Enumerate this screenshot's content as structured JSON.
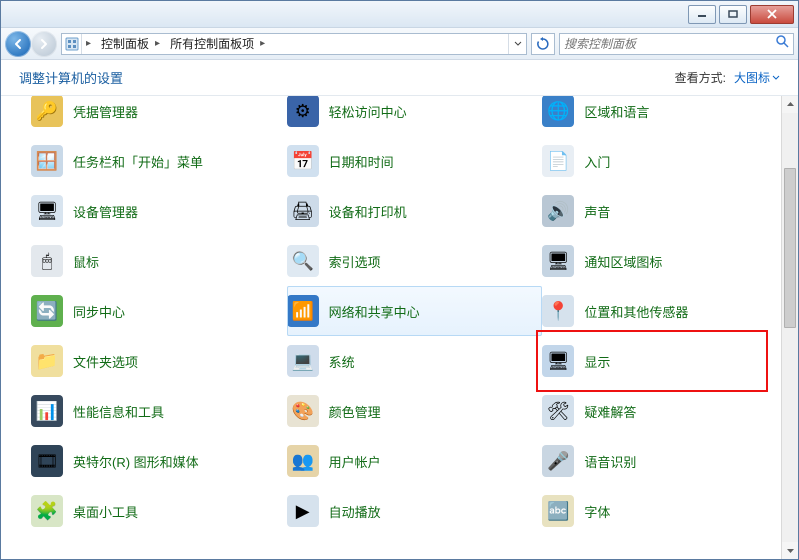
{
  "titlebar": {
    "minimize": "Minimize",
    "maximize": "Maximize",
    "close": "Close"
  },
  "breadcrumbs": [
    "控制面板",
    "所有控制面板项"
  ],
  "search": {
    "placeholder": "搜索控制面板"
  },
  "header": {
    "title": "调整计算机的设置",
    "view_label": "查看方式:",
    "view_value": "大图标"
  },
  "iconset": {
    "credential": "🔑",
    "ease": "⚙",
    "region": "🌐",
    "taskbar": "🪟",
    "datetime": "📅",
    "getting": "📄",
    "device_mgr": "🖥",
    "devices": "🖨",
    "sound": "🔊",
    "mouse": "🖱",
    "indexing": "🔍",
    "notification": "🖥",
    "sync": "🔄",
    "network": "📶",
    "sensors": "📍",
    "folder": "📁",
    "system": "💻",
    "display": "🖥",
    "perf": "📊",
    "color": "🎨",
    "troubleshoot": "🛠",
    "intel": "🎞",
    "users": "👥",
    "speech": "🎤",
    "gadgets": "🧩",
    "autoplay": "▶",
    "fonts": "🔤"
  },
  "items": [
    {
      "label": "凭据管理器",
      "icon": "credential",
      "bg": "#e8c35a"
    },
    {
      "label": "轻松访问中心",
      "icon": "ease",
      "bg": "#3a64a8"
    },
    {
      "label": "区域和语言",
      "icon": "region",
      "bg": "#3a80c8"
    },
    {
      "label": "任务栏和「开始」菜单",
      "icon": "taskbar",
      "bg": "#c9d9e8"
    },
    {
      "label": "日期和时间",
      "icon": "datetime",
      "bg": "#d0e0ef"
    },
    {
      "label": "入门",
      "icon": "getting",
      "bg": "#e8eef4"
    },
    {
      "label": "设备管理器",
      "icon": "device_mgr",
      "bg": "#d8e4ef"
    },
    {
      "label": "设备和打印机",
      "icon": "devices",
      "bg": "#cddbe9"
    },
    {
      "label": "声音",
      "icon": "sound",
      "bg": "#b9c7d4"
    },
    {
      "label": "鼠标",
      "icon": "mouse",
      "bg": "#e3e8ed"
    },
    {
      "label": "索引选项",
      "icon": "indexing",
      "bg": "#dfe9f2"
    },
    {
      "label": "通知区域图标",
      "icon": "notification",
      "bg": "#c5d4e2"
    },
    {
      "label": "同步中心",
      "icon": "sync",
      "bg": "#5fb04e"
    },
    {
      "label": "网络和共享中心",
      "icon": "network",
      "bg": "#3478c6",
      "hovered": true
    },
    {
      "label": "位置和其他传感器",
      "icon": "sensors",
      "bg": "#d6e2ed"
    },
    {
      "label": "文件夹选项",
      "icon": "folder",
      "bg": "#f0df9e"
    },
    {
      "label": "系统",
      "icon": "system",
      "bg": "#cfdceb"
    },
    {
      "label": "显示",
      "icon": "display",
      "bg": "#c2d6ea",
      "highlighted": true
    },
    {
      "label": "性能信息和工具",
      "icon": "perf",
      "bg": "#374a5e"
    },
    {
      "label": "颜色管理",
      "icon": "color",
      "bg": "#e8e3d3"
    },
    {
      "label": "疑难解答",
      "icon": "troubleshoot",
      "bg": "#d3e0ec"
    },
    {
      "label": "英特尔(R) 图形和媒体",
      "icon": "intel",
      "bg": "#2f4458"
    },
    {
      "label": "用户帐户",
      "icon": "users",
      "bg": "#e6d4a8"
    },
    {
      "label": "语音识别",
      "icon": "speech",
      "bg": "#c9d6e2"
    },
    {
      "label": "桌面小工具",
      "icon": "gadgets",
      "bg": "#d8e6c6"
    },
    {
      "label": "自动播放",
      "icon": "autoplay",
      "bg": "#d6e2ed"
    },
    {
      "label": "字体",
      "icon": "fonts",
      "bg": "#e8e2c0"
    }
  ]
}
